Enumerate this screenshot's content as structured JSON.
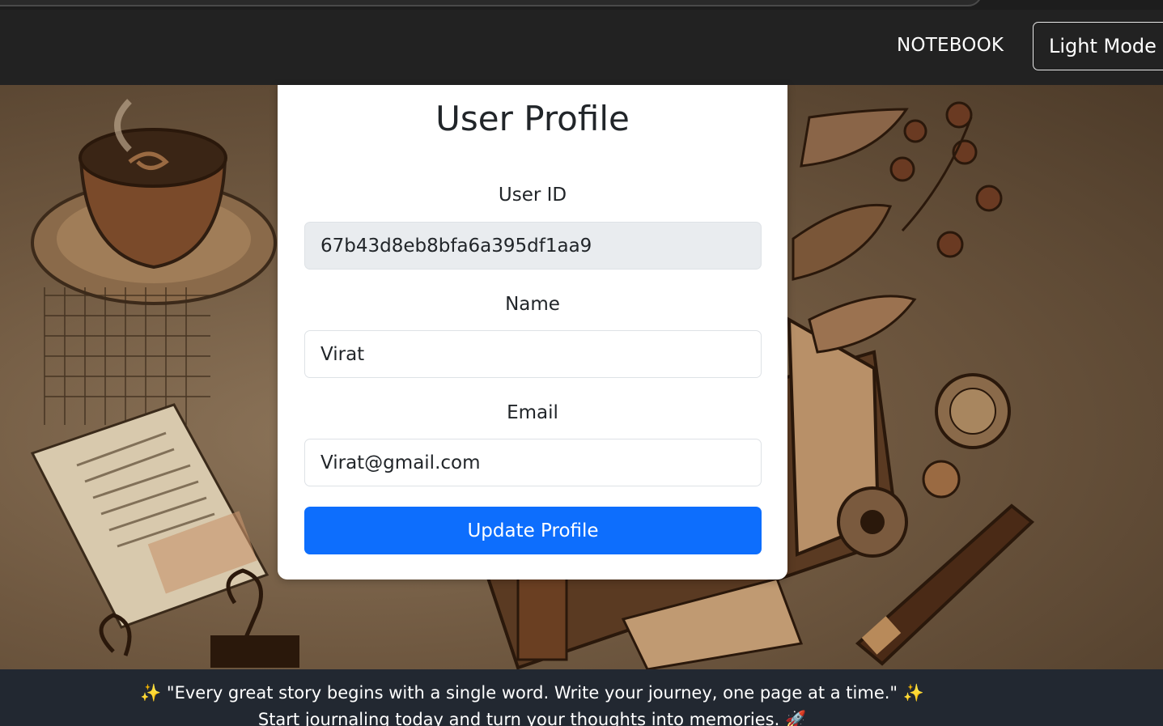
{
  "navbar": {
    "link_label": "NOTEBOOK",
    "mode_button_label": "Light Mode"
  },
  "profile": {
    "title": "User Profile",
    "user_id_label": "User ID",
    "user_id_value": "67b43d8eb8bfa6a395df1aa9",
    "name_label": "Name",
    "name_value": "Virat",
    "email_label": "Email",
    "email_value": "Virat@gmail.com",
    "submit_label": "Update Profile"
  },
  "footer": {
    "quote_sparkle_left": "✨",
    "quote": "\"Every great story begins with a single word. Write your journey, one page at a time.\"",
    "quote_sparkle_right": "✨",
    "tagline": "Start journaling today and turn your thoughts into memories.",
    "tagline_icon": "🚀"
  },
  "colors": {
    "navbar_bg": "#222222",
    "primary_button": "#0d6efd",
    "footer_bg": "#222831",
    "readonly_field_bg": "#e9ecef"
  },
  "icons": [
    "sparkles-icon",
    "rocket-icon"
  ]
}
